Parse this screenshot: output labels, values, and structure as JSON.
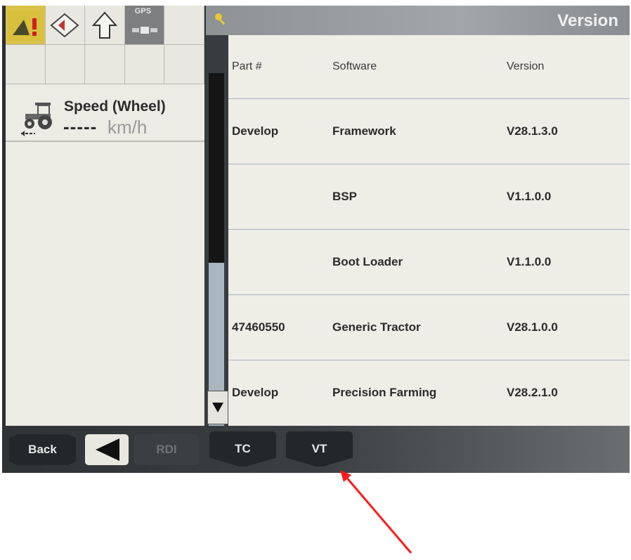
{
  "status_bar": {
    "gps_label": "GPS"
  },
  "speed_panel": {
    "title": "Speed (Wheel)",
    "value": "-----",
    "unit": "km/h"
  },
  "window": {
    "title": "Version"
  },
  "version_table": {
    "headers": [
      "Part #",
      "Software",
      "Version"
    ],
    "rows": [
      {
        "part": "Develop",
        "software": "Framework",
        "version": "V28.1.3.0"
      },
      {
        "part": "",
        "software": "BSP",
        "version": "V1.1.0.0"
      },
      {
        "part": "",
        "software": "Boot Loader",
        "version": "V1.1.0.0"
      },
      {
        "part": "47460550",
        "software": "Generic Tractor",
        "version": "V28.1.0.0"
      },
      {
        "part": "Develop",
        "software": "Precision Farming",
        "version": "V28.2.1.0"
      }
    ]
  },
  "bottom_bar": {
    "back_label": "Back",
    "rdi_label": "RDI",
    "tc_label": "TC",
    "vt_label": "VT"
  },
  "colors": {
    "annotation_arrow": "#ff1a1a",
    "screen_background": "#eeede6",
    "scroll_thumb": "#151515"
  }
}
